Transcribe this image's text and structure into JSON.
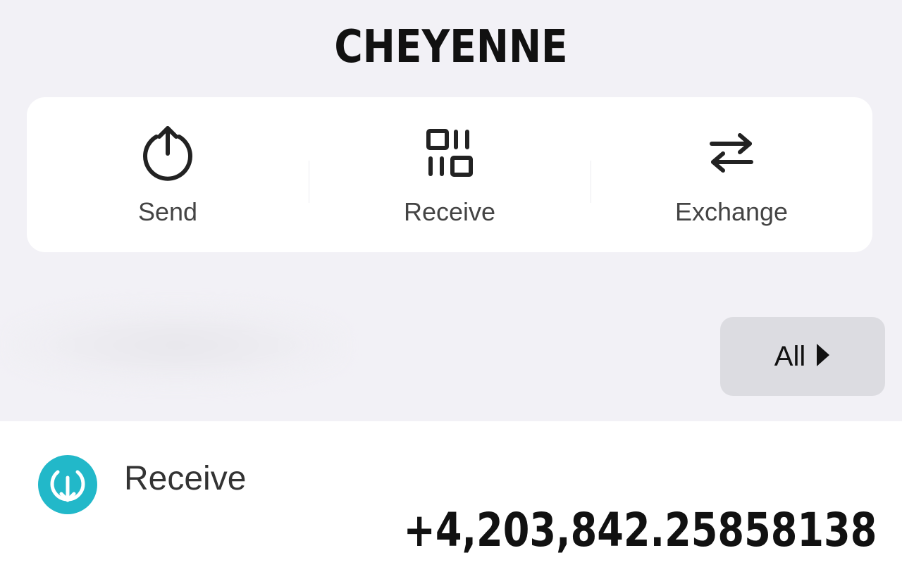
{
  "header": {
    "title": "CHEYENNE"
  },
  "actions": [
    {
      "label": "Send",
      "icon": "send-icon"
    },
    {
      "label": "Receive",
      "icon": "qr-code-icon"
    },
    {
      "label": "Exchange",
      "icon": "exchange-arrows-icon"
    }
  ],
  "filter": {
    "all_label": "All",
    "icon": "caret-right-icon"
  },
  "transactions": [
    {
      "type_label": "Receive",
      "icon": "receive-download-icon",
      "icon_color": "#22b8c9",
      "amount": "+4,203,842.25858138"
    }
  ],
  "colors": {
    "background": "#f2f1f6",
    "card": "#ffffff",
    "accent": "#22b8c9",
    "button_gray": "#dcdce1"
  }
}
